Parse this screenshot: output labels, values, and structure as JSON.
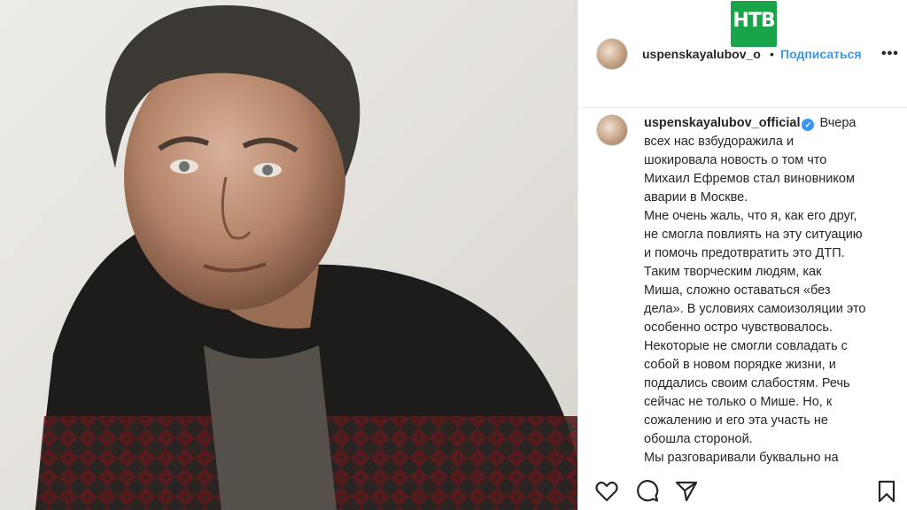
{
  "header": {
    "username": "uspenskayalubov_o",
    "dot": "•",
    "follow_label": "Подписаться",
    "more_label": "•••"
  },
  "watermark": {
    "text": "НТВ",
    "color": "#19a44a"
  },
  "caption": {
    "username": "uspenskayalubov_official",
    "lines": [
      "Вчера",
      "всех нас взбудоражила и",
      "шокировала новость о том что",
      "Михаил Ефремов стал виновником",
      "аварии в Москве.",
      "Мне очень жаль, что я, как его друг,",
      "не смогла повлиять на эту ситуацию",
      "и помочь предотвратить это ДТП.",
      "Таким творческим людям, как",
      "Миша, сложно оставаться «без",
      "дела». В условиях самоизоляции это",
      "особенно остро чувствовалось.",
      "Некоторые не смогли совладать с",
      "собой в новом порядке жизни, и",
      "поддались своим слабостям. Речь",
      "сейчас не только о Мише. Но, к",
      "сожалению и его эта участь не",
      "обошла стороной.",
      "Мы разговаривали буквально на"
    ]
  },
  "icons": {
    "like": "heart-icon",
    "comment": "comment-icon",
    "share": "share-icon",
    "save": "bookmark-icon",
    "verified": "verified-badge-icon"
  },
  "colors": {
    "link": "#3897f0",
    "text": "#262626",
    "border": "#efefef"
  }
}
